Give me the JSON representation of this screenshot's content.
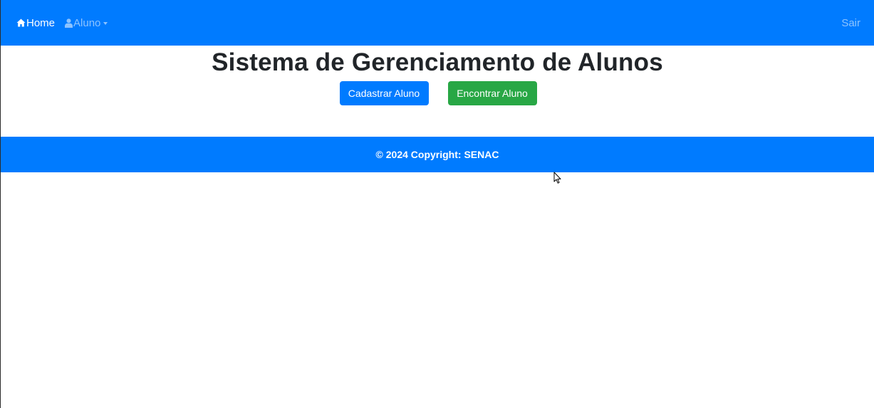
{
  "navbar": {
    "home_label": "Home",
    "aluno_label": "Aluno",
    "sair_label": "Sair",
    "home_icon": "home-icon",
    "aluno_icon": "user-icon",
    "background_color": "#007bff"
  },
  "main": {
    "title": "Sistema de Gerenciamento de Alunos",
    "cadastrar_label": "Cadastrar Aluno",
    "encontrar_label": "Encontrar Aluno",
    "primary_color": "#007bff",
    "success_color": "#28a745"
  },
  "footer": {
    "text": "© 2024 Copyright: SENAC"
  }
}
